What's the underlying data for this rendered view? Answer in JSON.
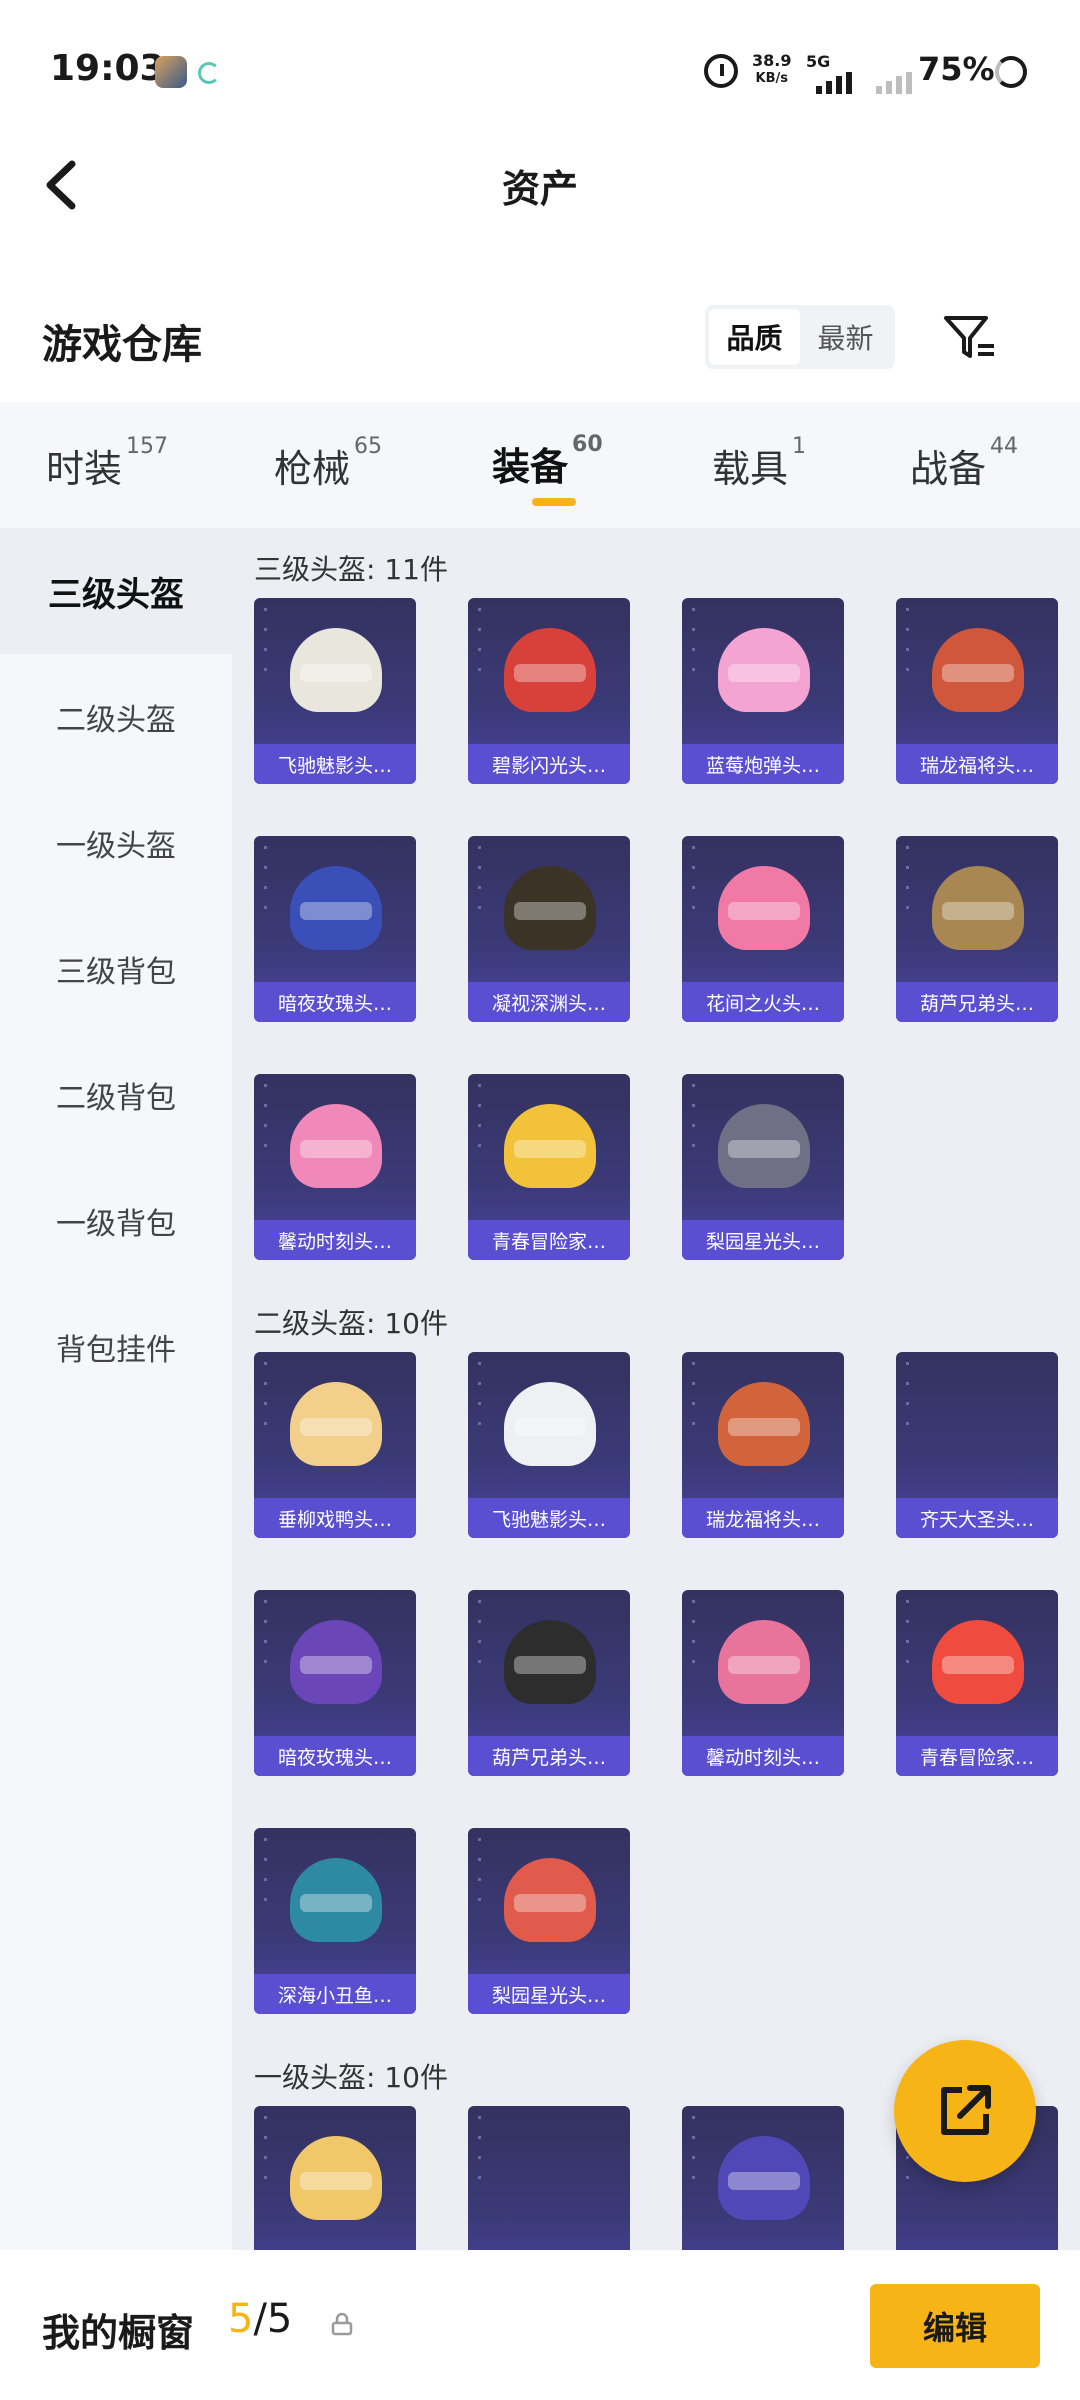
{
  "status_bar": {
    "time": "19:03",
    "net_speed_top": "38.9",
    "net_speed_unit": "KB/s",
    "net_gen": "5G",
    "battery": "75%"
  },
  "header": {
    "title": "资产"
  },
  "warehouse": {
    "title": "游戏仓库",
    "sort_quality": "品质",
    "sort_newest": "最新"
  },
  "tabs": [
    {
      "label": "时装",
      "count": "157"
    },
    {
      "label": "枪械",
      "count": "65"
    },
    {
      "label": "装备",
      "count": "60"
    },
    {
      "label": "载具",
      "count": "1"
    },
    {
      "label": "战备",
      "count": "44"
    }
  ],
  "sidebar": [
    "三级头盔",
    "二级头盔",
    "一级头盔",
    "三级背包",
    "二级背包",
    "一级背包",
    "背包挂件"
  ],
  "groups": [
    {
      "label": "三级头盔: 11件",
      "items": [
        "飞驰魅影头…",
        "碧影闪光头…",
        "蓝莓炮弹头…",
        "瑞龙福将头…",
        "暗夜玫瑰头…",
        "凝视深渊头…",
        "花间之火头…",
        "葫芦兄弟头…",
        "馨动时刻头…",
        "青春冒险家…",
        "梨园星光头…"
      ]
    },
    {
      "label": "二级头盔: 10件",
      "items": [
        "垂柳戏鸭头…",
        "飞驰魅影头…",
        "瑞龙福将头…",
        "齐天大圣头…",
        "暗夜玫瑰头…",
        "葫芦兄弟头…",
        "馨动时刻头…",
        "青春冒险家…",
        "深海小丑鱼…",
        "梨园星光头…"
      ]
    },
    {
      "label": "一级头盔: 10件",
      "items": [
        "",
        "",
        "",
        ""
      ]
    }
  ],
  "helmet_colors": {
    "g0": [
      "#e9e6dd",
      "#d8403a",
      "#f3a4d2",
      "#d0573c",
      "#3a4fb8",
      "#3b3326",
      "#f07aa5",
      "#a88752",
      "#f089b9",
      "#f2c33a",
      "#6f6f86"
    ],
    "g1": [
      "#f2cf8a",
      "#eef0f3",
      "#d2643c",
      "",
      "#6a46b8",
      "#2d2d2d",
      "#e8749c",
      "#f04b3f",
      "#2e8aa2",
      "#e05b4c"
    ],
    "g2": [
      "#f0c86a",
      "",
      "#4f48b6",
      ""
    ]
  },
  "bottom": {
    "label": "我的橱窗",
    "count_current": "5",
    "count_total": "/5",
    "edit": "编辑"
  },
  "colors": {
    "accent": "#f6b416",
    "card_caption": "#5b4fd1"
  }
}
